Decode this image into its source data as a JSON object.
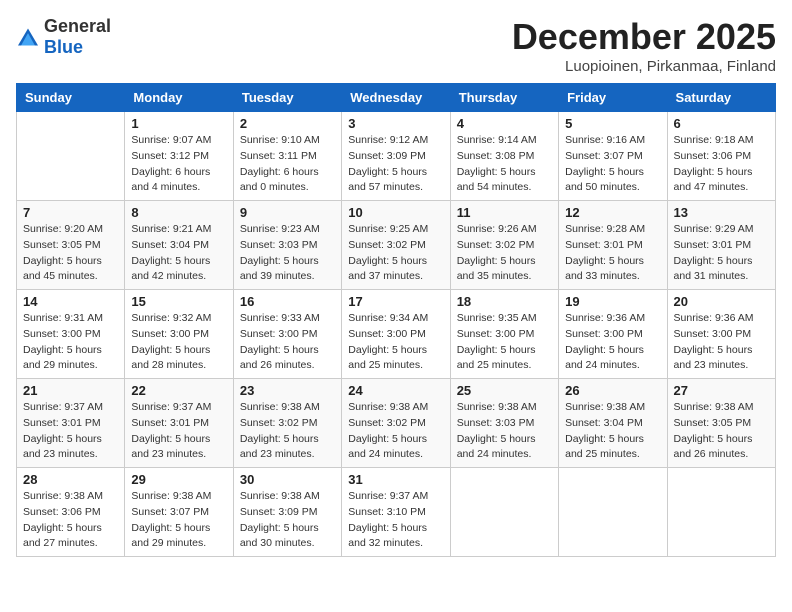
{
  "logo": {
    "general": "General",
    "blue": "Blue"
  },
  "title": {
    "month": "December 2025",
    "location": "Luopioinen, Pirkanmaa, Finland"
  },
  "headers": [
    "Sunday",
    "Monday",
    "Tuesday",
    "Wednesday",
    "Thursday",
    "Friday",
    "Saturday"
  ],
  "weeks": [
    [
      {
        "day": "",
        "info": ""
      },
      {
        "day": "1",
        "info": "Sunrise: 9:07 AM\nSunset: 3:12 PM\nDaylight: 6 hours\nand 4 minutes."
      },
      {
        "day": "2",
        "info": "Sunrise: 9:10 AM\nSunset: 3:11 PM\nDaylight: 6 hours\nand 0 minutes."
      },
      {
        "day": "3",
        "info": "Sunrise: 9:12 AM\nSunset: 3:09 PM\nDaylight: 5 hours\nand 57 minutes."
      },
      {
        "day": "4",
        "info": "Sunrise: 9:14 AM\nSunset: 3:08 PM\nDaylight: 5 hours\nand 54 minutes."
      },
      {
        "day": "5",
        "info": "Sunrise: 9:16 AM\nSunset: 3:07 PM\nDaylight: 5 hours\nand 50 minutes."
      },
      {
        "day": "6",
        "info": "Sunrise: 9:18 AM\nSunset: 3:06 PM\nDaylight: 5 hours\nand 47 minutes."
      }
    ],
    [
      {
        "day": "7",
        "info": "Sunrise: 9:20 AM\nSunset: 3:05 PM\nDaylight: 5 hours\nand 45 minutes."
      },
      {
        "day": "8",
        "info": "Sunrise: 9:21 AM\nSunset: 3:04 PM\nDaylight: 5 hours\nand 42 minutes."
      },
      {
        "day": "9",
        "info": "Sunrise: 9:23 AM\nSunset: 3:03 PM\nDaylight: 5 hours\nand 39 minutes."
      },
      {
        "day": "10",
        "info": "Sunrise: 9:25 AM\nSunset: 3:02 PM\nDaylight: 5 hours\nand 37 minutes."
      },
      {
        "day": "11",
        "info": "Sunrise: 9:26 AM\nSunset: 3:02 PM\nDaylight: 5 hours\nand 35 minutes."
      },
      {
        "day": "12",
        "info": "Sunrise: 9:28 AM\nSunset: 3:01 PM\nDaylight: 5 hours\nand 33 minutes."
      },
      {
        "day": "13",
        "info": "Sunrise: 9:29 AM\nSunset: 3:01 PM\nDaylight: 5 hours\nand 31 minutes."
      }
    ],
    [
      {
        "day": "14",
        "info": "Sunrise: 9:31 AM\nSunset: 3:00 PM\nDaylight: 5 hours\nand 29 minutes."
      },
      {
        "day": "15",
        "info": "Sunrise: 9:32 AM\nSunset: 3:00 PM\nDaylight: 5 hours\nand 28 minutes."
      },
      {
        "day": "16",
        "info": "Sunrise: 9:33 AM\nSunset: 3:00 PM\nDaylight: 5 hours\nand 26 minutes."
      },
      {
        "day": "17",
        "info": "Sunrise: 9:34 AM\nSunset: 3:00 PM\nDaylight: 5 hours\nand 25 minutes."
      },
      {
        "day": "18",
        "info": "Sunrise: 9:35 AM\nSunset: 3:00 PM\nDaylight: 5 hours\nand 25 minutes."
      },
      {
        "day": "19",
        "info": "Sunrise: 9:36 AM\nSunset: 3:00 PM\nDaylight: 5 hours\nand 24 minutes."
      },
      {
        "day": "20",
        "info": "Sunrise: 9:36 AM\nSunset: 3:00 PM\nDaylight: 5 hours\nand 23 minutes."
      }
    ],
    [
      {
        "day": "21",
        "info": "Sunrise: 9:37 AM\nSunset: 3:01 PM\nDaylight: 5 hours\nand 23 minutes."
      },
      {
        "day": "22",
        "info": "Sunrise: 9:37 AM\nSunset: 3:01 PM\nDaylight: 5 hours\nand 23 minutes."
      },
      {
        "day": "23",
        "info": "Sunrise: 9:38 AM\nSunset: 3:02 PM\nDaylight: 5 hours\nand 23 minutes."
      },
      {
        "day": "24",
        "info": "Sunrise: 9:38 AM\nSunset: 3:02 PM\nDaylight: 5 hours\nand 24 minutes."
      },
      {
        "day": "25",
        "info": "Sunrise: 9:38 AM\nSunset: 3:03 PM\nDaylight: 5 hours\nand 24 minutes."
      },
      {
        "day": "26",
        "info": "Sunrise: 9:38 AM\nSunset: 3:04 PM\nDaylight: 5 hours\nand 25 minutes."
      },
      {
        "day": "27",
        "info": "Sunrise: 9:38 AM\nSunset: 3:05 PM\nDaylight: 5 hours\nand 26 minutes."
      }
    ],
    [
      {
        "day": "28",
        "info": "Sunrise: 9:38 AM\nSunset: 3:06 PM\nDaylight: 5 hours\nand 27 minutes."
      },
      {
        "day": "29",
        "info": "Sunrise: 9:38 AM\nSunset: 3:07 PM\nDaylight: 5 hours\nand 29 minutes."
      },
      {
        "day": "30",
        "info": "Sunrise: 9:38 AM\nSunset: 3:09 PM\nDaylight: 5 hours\nand 30 minutes."
      },
      {
        "day": "31",
        "info": "Sunrise: 9:37 AM\nSunset: 3:10 PM\nDaylight: 5 hours\nand 32 minutes."
      },
      {
        "day": "",
        "info": ""
      },
      {
        "day": "",
        "info": ""
      },
      {
        "day": "",
        "info": ""
      }
    ]
  ]
}
